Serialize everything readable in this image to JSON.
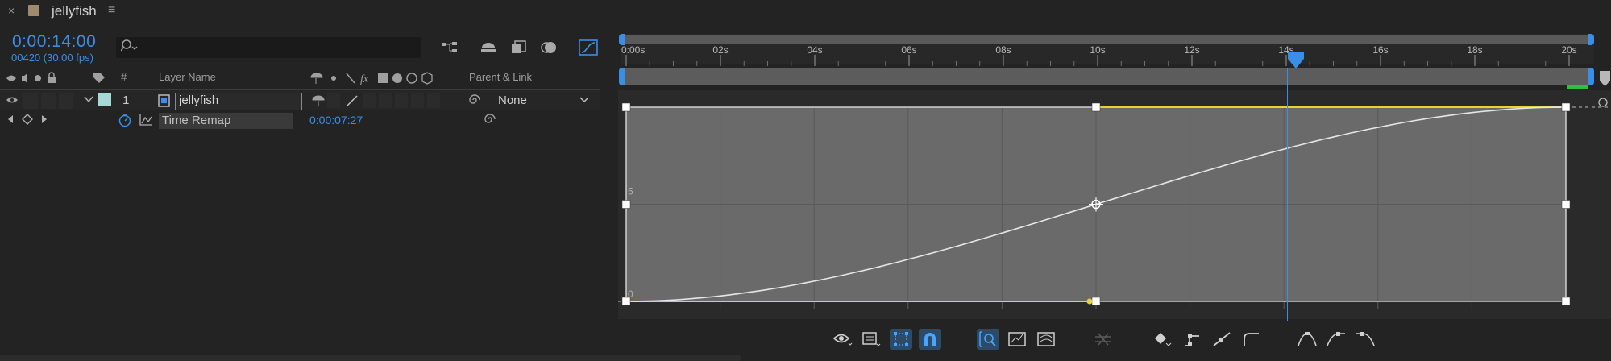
{
  "tab": {
    "close": "×",
    "title": "jellyfish",
    "menu": "≡"
  },
  "timeline": {
    "timecode": "0:00:14:00",
    "frames": "00420 (30.00 fps)"
  },
  "search": {
    "icon": "search-icon"
  },
  "columns": {
    "hash": "#",
    "layer_name": "Layer Name",
    "parent_link": "Parent & Link"
  },
  "layer": {
    "index": "1",
    "name": "jellyfish",
    "parent": "None"
  },
  "property": {
    "name": "Time Remap",
    "value": "0:00:07:27"
  },
  "ruler": {
    "ticks": [
      "0:00s",
      "02s",
      "04s",
      "06s",
      "08s",
      "10s",
      "12s",
      "14s",
      "16s",
      "18s",
      "20s"
    ]
  },
  "graph": {
    "y_labels": [
      "5",
      "0"
    ]
  },
  "colors": {
    "accent": "#3a8ee6",
    "curve": "#e6e6e6",
    "keyframe_line": "#e8d23a",
    "graph_bg": "#6a6a6a"
  }
}
